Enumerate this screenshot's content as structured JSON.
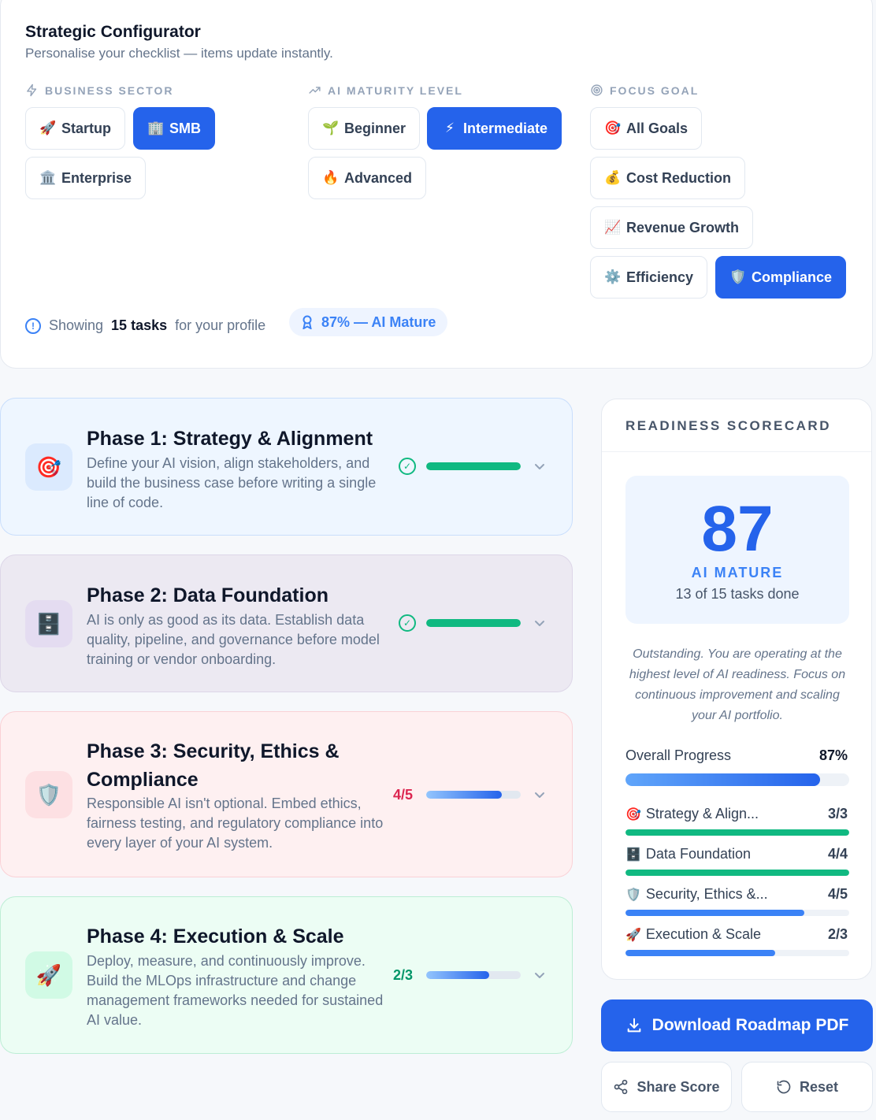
{
  "configurator": {
    "title": "Strategic Configurator",
    "subtitle": "Personalise your checklist — items update instantly.",
    "sector": {
      "heading": "BUSINESS SECTOR",
      "options": [
        {
          "emoji": "🚀",
          "label": "Startup"
        },
        {
          "emoji": "🏢",
          "label": "SMB"
        },
        {
          "emoji": "🏛️",
          "label": "Enterprise"
        }
      ],
      "selected": "SMB"
    },
    "maturity": {
      "heading": "AI MATURITY LEVEL",
      "options": [
        {
          "emoji": "🌱",
          "label": "Beginner"
        },
        {
          "emoji": "⚡",
          "label": "Intermediate"
        },
        {
          "emoji": "🔥",
          "label": "Advanced"
        }
      ],
      "selected": "Intermediate"
    },
    "goal": {
      "heading": "FOCUS GOAL",
      "options": [
        {
          "emoji": "🎯",
          "label": "All Goals"
        },
        {
          "emoji": "💰",
          "label": "Cost Reduction"
        },
        {
          "emoji": "📈",
          "label": "Revenue Growth"
        },
        {
          "emoji": "⚙️",
          "label": "Efficiency"
        },
        {
          "emoji": "🛡️",
          "label": "Compliance"
        }
      ],
      "selected": "Compliance"
    },
    "info": {
      "prefix": "Showing",
      "count": "15 tasks",
      "suffix": "for your profile",
      "badge": "87% — AI Mature"
    }
  },
  "phases": [
    {
      "icon": "🎯",
      "title": "Phase 1: Strategy & Alignment",
      "description": "Define your AI vision, align stakeholders, and build the business case before writing a single line of code.",
      "done": 3,
      "total": 3,
      "complete": true
    },
    {
      "icon": "🗄️",
      "title": "Phase 2: Data Foundation",
      "description": "AI is only as good as its data. Establish data quality, pipeline, and governance before model training or vendor onboarding.",
      "done": 4,
      "total": 4,
      "complete": true
    },
    {
      "icon": "🛡️",
      "title": "Phase 3: Security, Ethics & Compliance",
      "description": "Responsible AI isn't optional. Embed ethics, fairness testing, and regulatory compliance into every layer of your AI system.",
      "count_label": "4/5",
      "done": 4,
      "total": 5,
      "complete": false
    },
    {
      "icon": "🚀",
      "title": "Phase 4: Execution & Scale",
      "description": "Deploy, measure, and continuously improve. Build the MLOps infrastructure and change management frameworks needed for sustained AI value.",
      "count_label": "2/3",
      "done": 2,
      "total": 3,
      "complete": false
    }
  ],
  "scorecard": {
    "heading": "READINESS SCORECARD",
    "score": "87",
    "level": "AI MATURE",
    "tasks_done": "13 of 15 tasks done",
    "message": "Outstanding. You are operating at the highest level of AI readiness. Focus on continuous improvement and scaling your AI portfolio.",
    "overall_label": "Overall Progress",
    "overall_value": "87%",
    "overall_fraction": 0.87,
    "breakdown": [
      {
        "emoji": "🎯",
        "label": "Strategy & Align...",
        "value": "3/3",
        "fraction": 1.0,
        "color": "#10b981"
      },
      {
        "emoji": "🗄️",
        "label": "Data Foundation",
        "value": "4/4",
        "fraction": 1.0,
        "color": "#10b981"
      },
      {
        "emoji": "🛡️",
        "label": "Security, Ethics &...",
        "value": "4/5",
        "fraction": 0.8,
        "color": "#3b82f6"
      },
      {
        "emoji": "🚀",
        "label": "Execution & Scale",
        "value": "2/3",
        "fraction": 0.67,
        "color": "#3b82f6"
      }
    ]
  },
  "actions": {
    "download": "Download Roadmap PDF",
    "share": "Share Score",
    "reset": "Reset"
  },
  "colors": {
    "accent": "#2563eb",
    "success": "#10b981",
    "phase3_count": "#dc2650",
    "phase4_count": "#059669"
  }
}
